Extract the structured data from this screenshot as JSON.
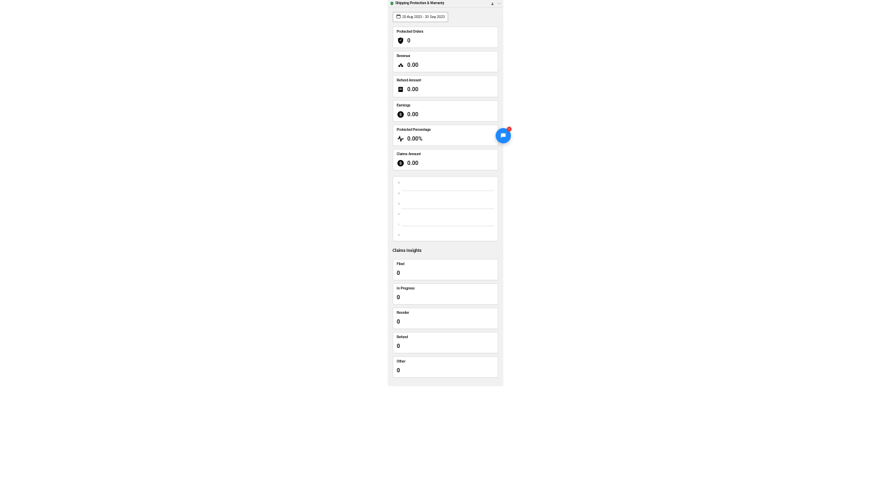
{
  "titlebar": {
    "app_name": "Shipping Protection & Warranty"
  },
  "dateRange": {
    "label": "20 Aug 2023 - 20 Sep 2023"
  },
  "summary_cards": [
    {
      "label": "Protected Orders",
      "value": "0",
      "icon": "shield-check-icon"
    },
    {
      "label": "Revenue",
      "value": "0.00",
      "icon": "coins-icon"
    },
    {
      "label": "Refund Amount",
      "value": "0.00",
      "icon": "receipt-icon"
    },
    {
      "label": "Earnings",
      "value": "0.00",
      "icon": "dollar-circle-icon"
    },
    {
      "label": "Protected Percentage",
      "value": "0.00%",
      "icon": "activity-icon"
    },
    {
      "label": "Claims Amount",
      "value": "0.00",
      "icon": "dollar-circle-icon"
    }
  ],
  "claims_insights": {
    "header": "Claims Insights",
    "cards": [
      {
        "label": "Filed",
        "value": "0"
      },
      {
        "label": "In Progress",
        "value": "0"
      },
      {
        "label": "Reorder",
        "value": "0"
      },
      {
        "label": "Refund",
        "value": "0"
      },
      {
        "label": "Other",
        "value": "0"
      }
    ]
  },
  "chat": {
    "badge": "1"
  },
  "chart_data": {
    "type": "bar",
    "categories": [],
    "values": [],
    "title": "",
    "xlabel": "",
    "ylabel": "",
    "ylim": [
      0,
      5
    ],
    "yticks": [
      5,
      4,
      3,
      2,
      1,
      0
    ]
  }
}
